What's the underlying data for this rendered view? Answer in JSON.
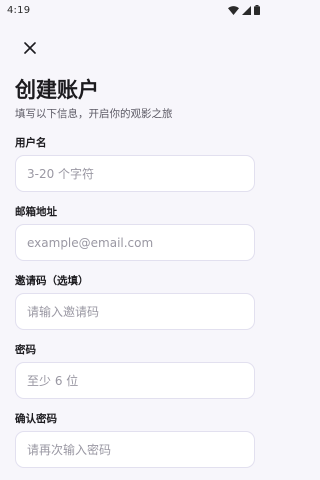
{
  "status_bar": {
    "time": "4:19",
    "icons": [
      "wifi-icon",
      "signal-icon",
      "battery-icon"
    ]
  },
  "header": {
    "close_icon": "close-icon",
    "title": "创建账户",
    "subtitle": "填写以下信息，开启你的观影之旅"
  },
  "form": {
    "username": {
      "label": "用户名",
      "placeholder": "3-20 个字符",
      "value": ""
    },
    "email": {
      "label": "邮箱地址",
      "placeholder": "example@email.com",
      "value": ""
    },
    "invite_code": {
      "label": "邀请码（选填）",
      "placeholder": "请输入邀请码",
      "value": ""
    },
    "password": {
      "label": "密码",
      "placeholder": "至少 6 位",
      "value": ""
    },
    "confirm_password": {
      "label": "确认密码",
      "placeholder": "请再次输入密码",
      "value": ""
    }
  },
  "colors": {
    "background": "#f7f6fb",
    "input_border": "#e2e0ef",
    "placeholder": "#9a98a3",
    "text_primary": "#1c1b1f",
    "text_secondary": "#5d5b66"
  }
}
